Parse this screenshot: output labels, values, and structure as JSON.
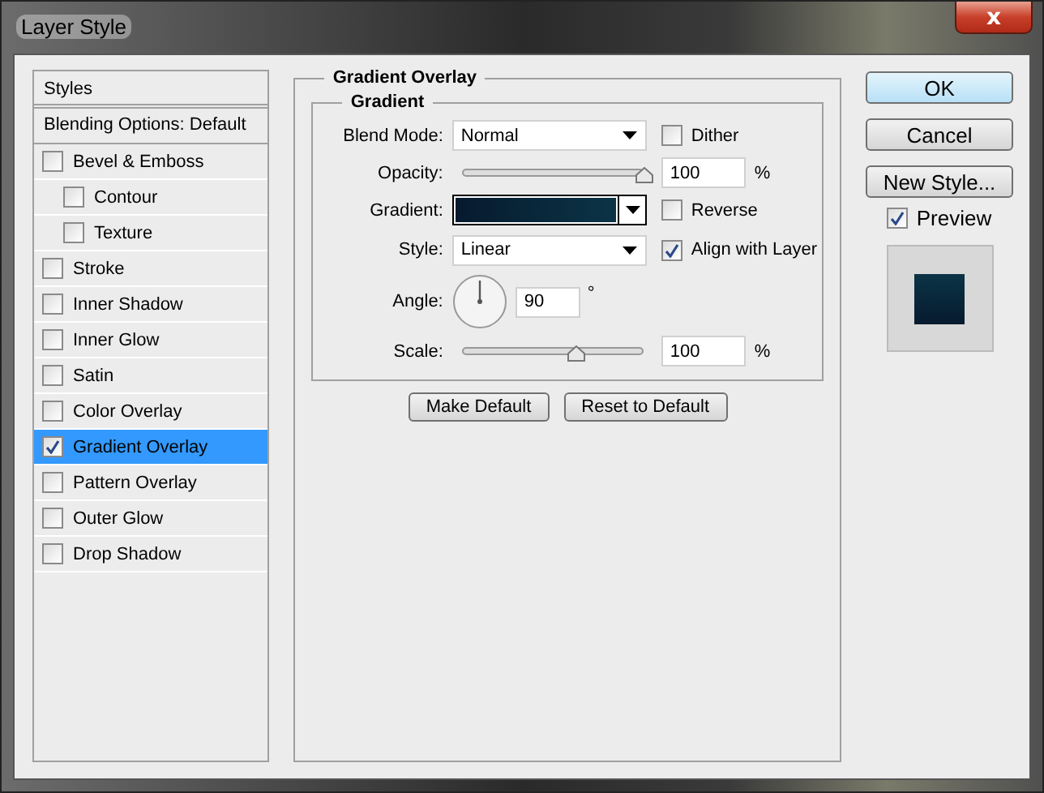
{
  "window": {
    "title": "Layer Style",
    "close_label": "x"
  },
  "styles_panel": {
    "header": "Styles",
    "blending_options": "Blending Options: Default",
    "items": [
      {
        "label": "Bevel & Emboss",
        "checked": false,
        "selected": false,
        "children": [
          {
            "label": "Contour",
            "checked": false,
            "selected": false
          },
          {
            "label": "Texture",
            "checked": false,
            "selected": false
          }
        ]
      },
      {
        "label": "Stroke",
        "checked": false,
        "selected": false
      },
      {
        "label": "Inner Shadow",
        "checked": false,
        "selected": false
      },
      {
        "label": "Inner Glow",
        "checked": false,
        "selected": false
      },
      {
        "label": "Satin",
        "checked": false,
        "selected": false
      },
      {
        "label": "Color Overlay",
        "checked": false,
        "selected": false
      },
      {
        "label": "Gradient Overlay",
        "checked": true,
        "selected": true
      },
      {
        "label": "Pattern Overlay",
        "checked": false,
        "selected": false
      },
      {
        "label": "Outer Glow",
        "checked": false,
        "selected": false
      },
      {
        "label": "Drop Shadow",
        "checked": false,
        "selected": false
      }
    ]
  },
  "gradient_overlay": {
    "title": "Gradient Overlay",
    "group_title": "Gradient",
    "blend_mode": {
      "label": "Blend Mode:",
      "value": "Normal"
    },
    "dither": {
      "label": "Dither",
      "checked": false
    },
    "opacity": {
      "label": "Opacity:",
      "level": 1,
      "value": "100",
      "unit": "%"
    },
    "gradient": {
      "label": "Gradient:"
    },
    "reverse": {
      "label": "Reverse",
      "checked": false
    },
    "style": {
      "label": "Style:",
      "value": "Linear"
    },
    "align_with_layer": {
      "label": "Align with Layer",
      "checked": true
    },
    "angle": {
      "label": "Angle:",
      "value": "90",
      "unit": "°"
    },
    "scale": {
      "label": "Scale:",
      "level": 0.62,
      "value": "100",
      "unit": "%"
    },
    "buttons": [
      "Make Default",
      "Reset to Default"
    ]
  },
  "actions": {
    "ok": "OK",
    "cancel": "Cancel",
    "new_style": "New Style...",
    "preview": {
      "label": "Preview",
      "checked": true
    }
  }
}
